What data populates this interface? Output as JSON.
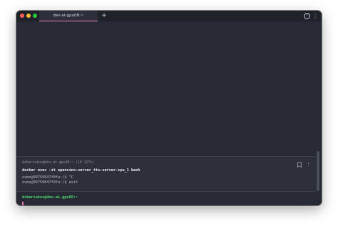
{
  "tab": {
    "title": "dev-ai-gpu08:~"
  },
  "titlebar": {
    "new_tab_glyph": "+",
    "help_glyph": "?",
    "menu_glyph": "⋮"
  },
  "block": {
    "header": "dsbarsukov@dev-ai-gpu08:~ (10.127s)",
    "command": "docker exec -it openvino-server_tts-server-cpu_1 bash",
    "output": [
      "ovms@99759047f0fa:/$ ^C",
      "ovms@99759047f0fa:/$ exit"
    ],
    "menu_glyph": "⋮"
  },
  "prompt": {
    "text": "dsbarsukov@dev-ai-gpu08:~"
  },
  "colors": {
    "background": "#272a34",
    "tab_accent": "#e879b9",
    "prompt": "#4fd26b"
  },
  "icons": [
    "help-icon",
    "more-vertical-icon",
    "bookmark-icon",
    "plus-icon"
  ]
}
